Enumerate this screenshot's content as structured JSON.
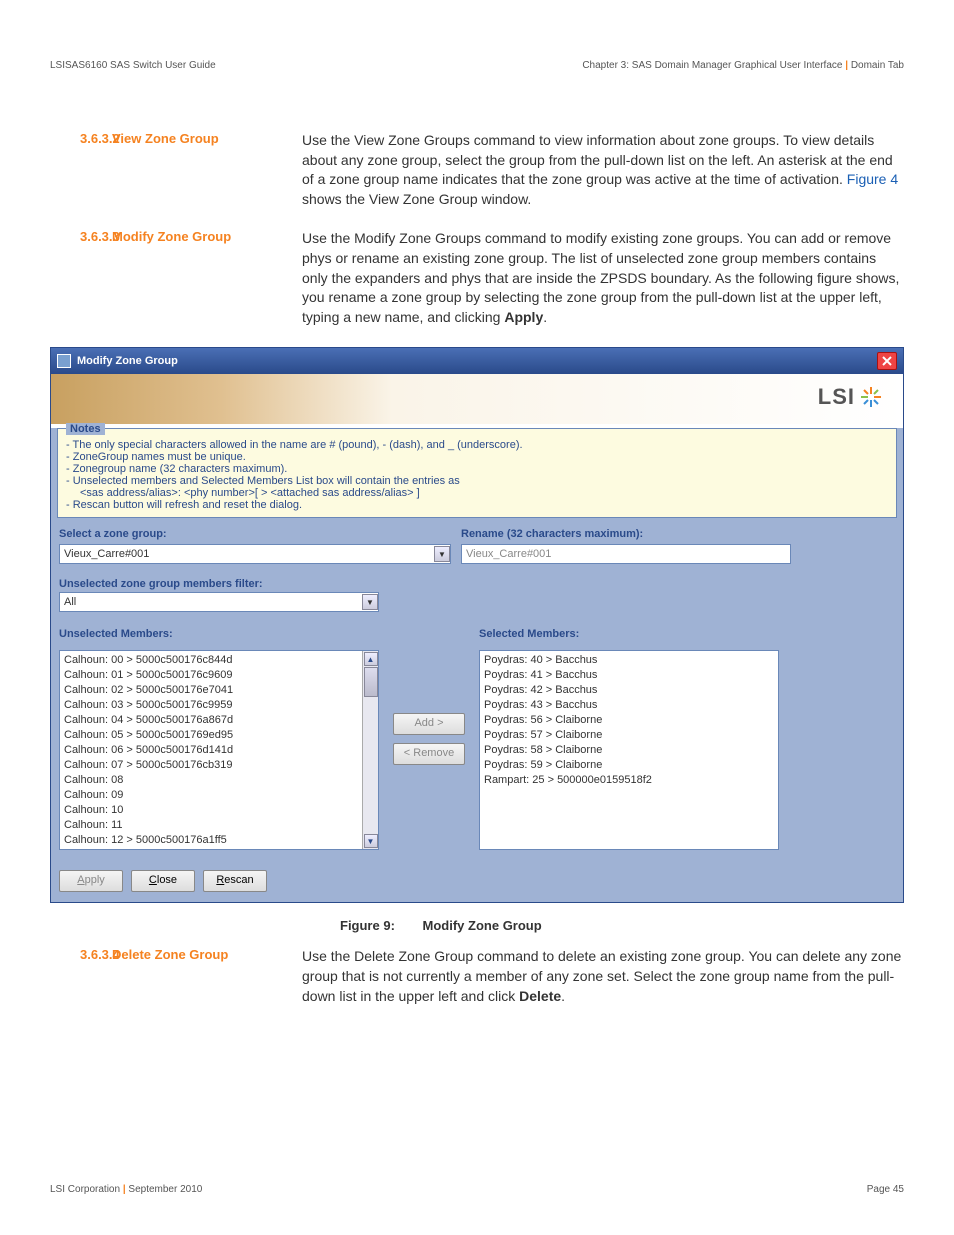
{
  "header": {
    "left": "LSISAS6160 SAS Switch User Guide",
    "right": "Chapter 3: SAS Domain Manager Graphical User Interface | Domain Tab"
  },
  "sections": {
    "s1": {
      "num": "3.6.3.2",
      "title": "View Zone Group",
      "body_a": "Use the View Zone Groups command to view information about zone groups. To view details about any zone group, select the group from the pull-down list on the left. An asterisk at the end of a zone group name indicates that the zone group was active at the time of activation. ",
      "link": "Figure 4",
      "body_b": " shows the View Zone Group window."
    },
    "s2": {
      "num": "3.6.3.3",
      "title": "Modify Zone Group",
      "body_a": "Use the Modify Zone Groups command to modify existing zone groups. You can add or remove phys or rename an existing zone group. The list of unselected zone group members contains only the expanders and phys that are inside the ZPSDS boundary. As the following figure shows, you rename a zone group by selecting the zone group from the pull-down list at the upper left, typing a new name, and clicking ",
      "bold": "Apply",
      "body_b": "."
    },
    "s3": {
      "num": "3.6.3.4",
      "title": "Delete Zone Group",
      "body_a": "Use the Delete Zone Group command to delete an existing zone group. You can delete any zone group that is not currently a member of any zone set. Select the zone group name from the pull-down list in the upper left and click ",
      "bold": "Delete",
      "body_b": "."
    }
  },
  "dialog": {
    "title": "Modify Zone Group",
    "logo": "LSI",
    "notes_legend": "Notes",
    "notes": [
      "The only special characters allowed in the name are # (pound), - (dash), and _ (underscore).",
      "ZoneGroup names must be unique.",
      "Zonegroup name (32 characters maximum).",
      "Unselected members and Selected Members List box will contain the entries as"
    ],
    "notes_indent": "<sas address/alias>: <phy number>[ > <attached sas address/alias> ]",
    "notes_last": "Rescan button will refresh and reset the dialog.",
    "select_label": "Select a zone group:",
    "rename_label": "Rename (32 characters maximum):",
    "select_value": "Vieux_Carre#001",
    "rename_value": "Vieux_Carre#001",
    "filter_label": "Unselected zone group members filter:",
    "filter_value": "All",
    "unselected_label": "Unselected Members:",
    "selected_label": "Selected Members:",
    "unselected": [
      "Calhoun: 00 > 5000c500176c844d",
      "Calhoun: 01 > 5000c500176c9609",
      "Calhoun: 02 > 5000c500176e7041",
      "Calhoun: 03 > 5000c500176c9959",
      "Calhoun: 04 > 5000c500176a867d",
      "Calhoun: 05 > 5000c5001769ed95",
      "Calhoun: 06 > 5000c500176d141d",
      "Calhoun: 07 > 5000c500176cb319",
      "Calhoun: 08",
      "Calhoun: 09",
      "Calhoun: 10",
      "Calhoun: 11",
      "Calhoun: 12 > 5000c500176a1ff5"
    ],
    "selected": [
      "Poydras: 40 > Bacchus",
      "Poydras: 41 > Bacchus",
      "Poydras: 42 > Bacchus",
      "Poydras: 43 > Bacchus",
      "Poydras: 56 > Claiborne",
      "Poydras: 57 > Claiborne",
      "Poydras: 58 > Claiborne",
      "Poydras: 59 > Claiborne",
      "Rampart: 25 > 500000e0159518f2"
    ],
    "btn_add": "Add >",
    "btn_remove": "< Remove",
    "btn_apply": "Apply",
    "btn_close": "Close",
    "btn_rescan": "Rescan"
  },
  "figure": {
    "label": "Figure 9:",
    "title": "Modify Zone Group"
  },
  "footer": {
    "left_a": "LSI Corporation",
    "left_b": "September 2010",
    "right": "Page 45"
  }
}
